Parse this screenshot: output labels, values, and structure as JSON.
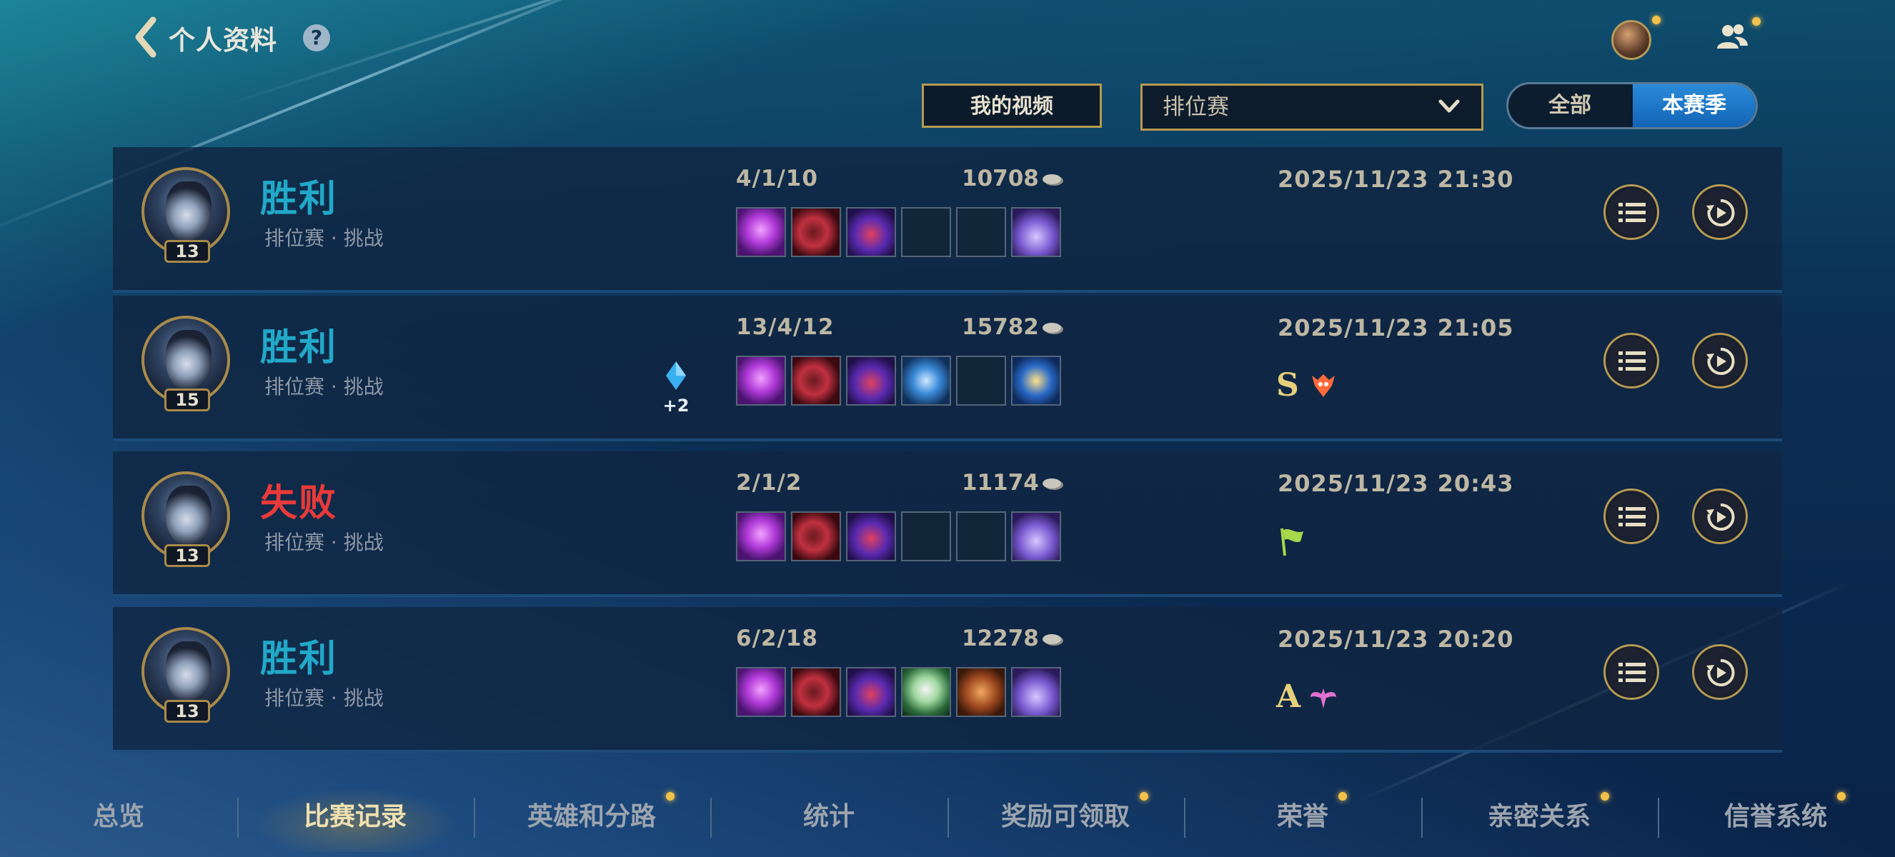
{
  "header": {
    "title": "个人资料",
    "help_icon": "?"
  },
  "filters": {
    "video_button": "我的视频",
    "mode_select": "排位赛",
    "scope": {
      "all": "全部",
      "season": "本赛季",
      "selected": "本赛季"
    }
  },
  "matches": [
    {
      "result": "胜利",
      "outcome": "win",
      "mode": "排位赛 · 挑战",
      "level": "13",
      "kda": "4/1/10",
      "gold": "10708",
      "date": "2025/11/23 21:30",
      "gem": "",
      "grade": "",
      "items": [
        "augment-purple",
        "helm-red",
        "hat-purple",
        "empty",
        "empty",
        "boots-purple"
      ]
    },
    {
      "result": "胜利",
      "outcome": "win",
      "mode": "排位赛 · 挑战",
      "level": "15",
      "kda": "13/4/12",
      "gold": "15782",
      "date": "2025/11/23 21:05",
      "gem": "+2",
      "grade": "S",
      "items": [
        "augment-purple",
        "helm-red",
        "hat-purple",
        "trident-blue",
        "empty",
        "hourglass-gold"
      ]
    },
    {
      "result": "失败",
      "outcome": "loss",
      "mode": "排位赛 · 挑战",
      "level": "13",
      "kda": "2/1/2",
      "gold": "11174",
      "date": "2025/11/23 20:43",
      "gem": "",
      "grade": "",
      "items": [
        "augment-purple",
        "helm-red",
        "hat-purple",
        "empty",
        "empty",
        "boots-purple"
      ]
    },
    {
      "result": "胜利",
      "outcome": "win",
      "mode": "排位赛 · 挑战",
      "level": "13",
      "kda": "6/2/18",
      "gold": "12278",
      "date": "2025/11/23 20:20",
      "gem": "",
      "grade": "A",
      "items": [
        "augment-purple",
        "helm-red",
        "hat-purple",
        "mask-green",
        "book-brown",
        "boots-purple"
      ]
    }
  ],
  "nav": {
    "tabs": [
      "总览",
      "比赛记录",
      "英雄和分路",
      "统计",
      "奖励可领取",
      "荣誉",
      "亲密关系",
      "信誉系统"
    ],
    "active": "比赛记录"
  },
  "colors": {
    "win": "#22a8c8",
    "loss": "#e83a3a",
    "gold_border": "#b69a52",
    "accent_blue": "#1e7bd0"
  }
}
